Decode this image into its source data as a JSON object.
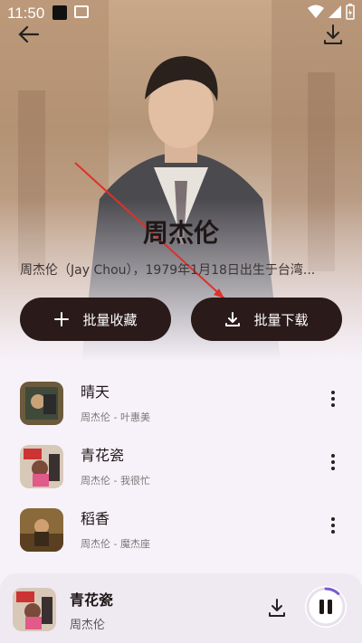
{
  "status_bar": {
    "time": "11:50"
  },
  "artist": {
    "name": "周杰伦",
    "bio": "周杰伦（Jay Chou），1979年1月18日出生于台湾..."
  },
  "actions": {
    "favorite_all": "批量收藏",
    "download_all": "批量下载"
  },
  "songs": [
    {
      "title": "晴天",
      "subtitle": "周杰伦 - 叶惠美"
    },
    {
      "title": "青花瓷",
      "subtitle": "周杰伦 - 我很忙"
    },
    {
      "title": "稻香",
      "subtitle": "周杰伦 - 魔杰座"
    }
  ],
  "now_playing": {
    "title": "青花瓷",
    "artist": "周杰伦",
    "progress": 0.12
  },
  "colors": {
    "accent_dark": "#2a1a1a",
    "progress": "#7a5bd0"
  }
}
